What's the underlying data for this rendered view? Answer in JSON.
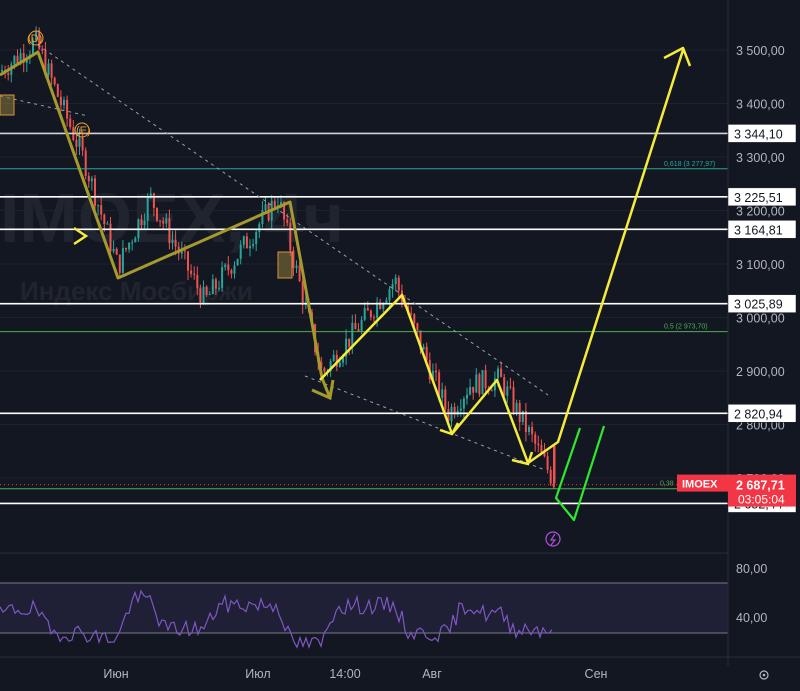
{
  "chart_data": {
    "type": "candlestick",
    "symbol": "IMOEX",
    "watermark": {
      "ticker": "IMOEX, 4ч",
      "exchange": "Индекс Мосбиржи"
    },
    "x_axis": {
      "labels": [
        "Июн",
        "Июл",
        "14:00",
        "Авг",
        "Сен"
      ]
    },
    "y_axis": {
      "range": [
        2600,
        3550
      ],
      "ticks": [
        {
          "value": 3500,
          "label": "3 500,00"
        },
        {
          "value": 3400,
          "label": "3 400,00"
        },
        {
          "value": 3300,
          "label": "3 300,00"
        },
        {
          "value": 3200,
          "label": "3 200,00"
        },
        {
          "value": 3100,
          "label": "3 100,00"
        },
        {
          "value": 3000,
          "label": "3 000,00"
        },
        {
          "value": 2900,
          "label": "2 900,00"
        },
        {
          "value": 2800,
          "label": "2 800,00"
        },
        {
          "value": 2700,
          "label": "2 700,00"
        }
      ]
    },
    "horizontal_levels": [
      {
        "value": 3344.1,
        "label": "3 344,10",
        "color": "#d1d4dc"
      },
      {
        "value": 3225.51,
        "label": "3 225,51",
        "color": "#ffffff"
      },
      {
        "value": 3164.81,
        "label": "3 164,81",
        "color": "#ffffff"
      },
      {
        "value": 3025.89,
        "label": "3 025,89",
        "color": "#ffffff"
      },
      {
        "value": 2820.94,
        "label": "2 820,94",
        "color": "#ffffff"
      },
      {
        "value": 2652.44,
        "label": "2 652,44",
        "color": "#ffffff"
      }
    ],
    "fib_levels": [
      {
        "value": 3277.97,
        "text": "0,618 (3 277,97)",
        "color": "#26a69a"
      },
      {
        "value": 2973.7,
        "text": "0,5 (2 973,70)",
        "color": "#4caf50"
      },
      {
        "value": 2680,
        "text": "0,38",
        "color": "#4caf50"
      }
    ],
    "current_price": {
      "symbol": "IMOEX",
      "price": "2 687,71",
      "countdown": "03:05:04",
      "value": 2687.71,
      "color": "#f23645"
    },
    "wave_labels": [
      "(D)",
      "(E)"
    ],
    "rsi": {
      "ticks": [
        "80,00",
        "40,00"
      ],
      "band_upper": 70,
      "band_lower": 30
    }
  }
}
